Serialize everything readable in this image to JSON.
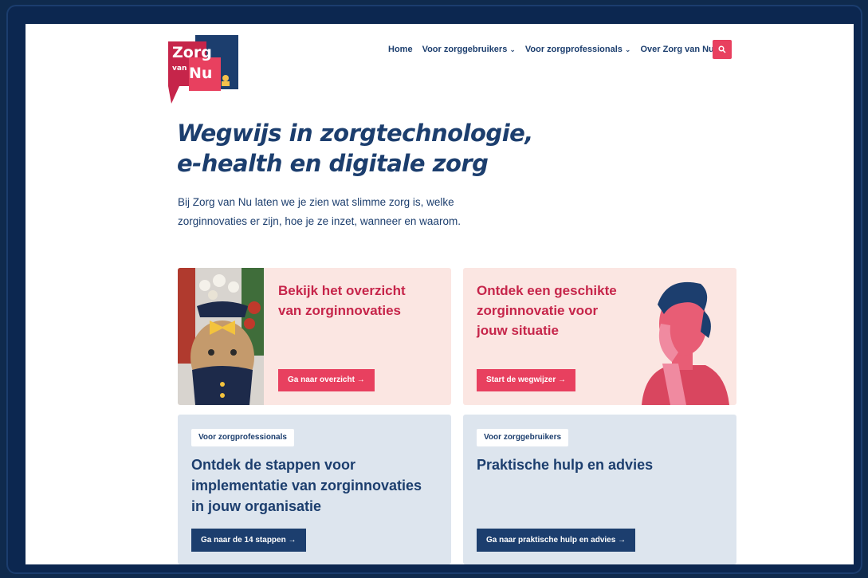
{
  "brand": {
    "logo_word_1": "Zorg",
    "logo_word_2": "van",
    "logo_word_3": "Nu",
    "colors": {
      "navy": "#1c3e6e",
      "pink": "#e8405f",
      "red": "#c6254a",
      "pink_bg": "#fbe6e2",
      "grey_bg": "#dde5ee"
    }
  },
  "nav": {
    "items": [
      {
        "label": "Home"
      },
      {
        "label": "Voor zorggebruikers",
        "icon": "chevron-down-icon"
      },
      {
        "label": "Voor zorgprofessionals",
        "icon": "chevron-down-icon"
      },
      {
        "label": "Over Zorg van Nu"
      }
    ],
    "search_icon": "search-icon"
  },
  "hero": {
    "title_line_1": "Wegwijs in zorgtechnologie,",
    "title_line_2": "e-health en digitale zorg",
    "intro_line_1": "Bij Zorg van Nu laten we je zien wat slimme zorg is, welke",
    "intro_line_2": "zorginnovaties er zijn, hoe je ze inzet, wanneer en waarom."
  },
  "cards": {
    "overview": {
      "title_line_1": "Bekijk het overzicht",
      "title_line_2": "van zorginnovaties",
      "button": "Ga naar overzicht →"
    },
    "wegwijzer": {
      "title_line_1": "Ontdek een geschikte",
      "title_line_2": "zorginnovatie voor",
      "title_line_3": "jouw situatie",
      "button": "Start de wegwijzer →"
    },
    "professionals": {
      "tag": "Voor zorgprofessionals",
      "title_line_1": "Ontdek de stappen voor",
      "title_line_2": "implementatie van zorginnovaties",
      "title_line_3": "in jouw organisatie",
      "button": "Ga naar de 14 stappen →"
    },
    "users": {
      "tag": "Voor zorggebruikers",
      "title_line_1": "Praktische hulp en advies",
      "button": "Ga naar praktische hulp en advies →"
    }
  }
}
